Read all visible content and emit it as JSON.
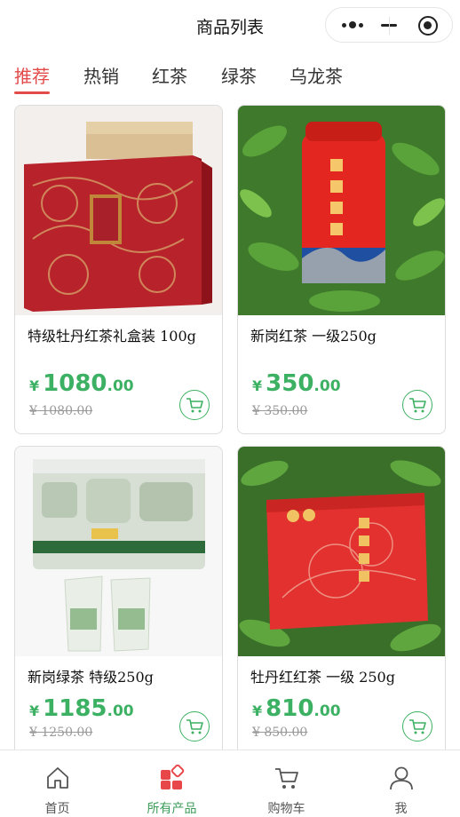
{
  "header": {
    "title": "商品列表"
  },
  "tabs": [
    {
      "label": "推荐",
      "active": true
    },
    {
      "label": "热销",
      "active": false
    },
    {
      "label": "红茶",
      "active": false
    },
    {
      "label": "绿茶",
      "active": false
    },
    {
      "label": "乌龙茶",
      "active": false
    }
  ],
  "products": [
    {
      "name": "特级牡丹红茶礼盒装 100g",
      "currency": "¥",
      "price_int": "1080",
      "price_dec": ".00",
      "old_price": "¥ 1080.00"
    },
    {
      "name": "新岗红茶 一级250g",
      "currency": "¥",
      "price_int": "350",
      "price_dec": ".00",
      "old_price": "¥ 350.00"
    },
    {
      "name": "新岗绿茶 特级250g",
      "currency": "¥",
      "price_int": "1185",
      "price_dec": ".00",
      "old_price": "¥ 1250.00"
    },
    {
      "name": "牡丹红红茶 一级 250g",
      "currency": "¥",
      "price_int": "810",
      "price_dec": ".00",
      "old_price": "¥ 850.00"
    }
  ],
  "bottom_nav": [
    {
      "label": "首页",
      "icon": "home-icon",
      "active": false
    },
    {
      "label": "所有产品",
      "icon": "grid-icon",
      "active": true
    },
    {
      "label": "购物车",
      "icon": "cart-icon",
      "active": false
    },
    {
      "label": "我",
      "icon": "user-icon",
      "active": false
    }
  ],
  "colors": {
    "accent_red": "#e34b4b",
    "price_green": "#3db163",
    "nav_active_green": "#3d9c5a"
  }
}
